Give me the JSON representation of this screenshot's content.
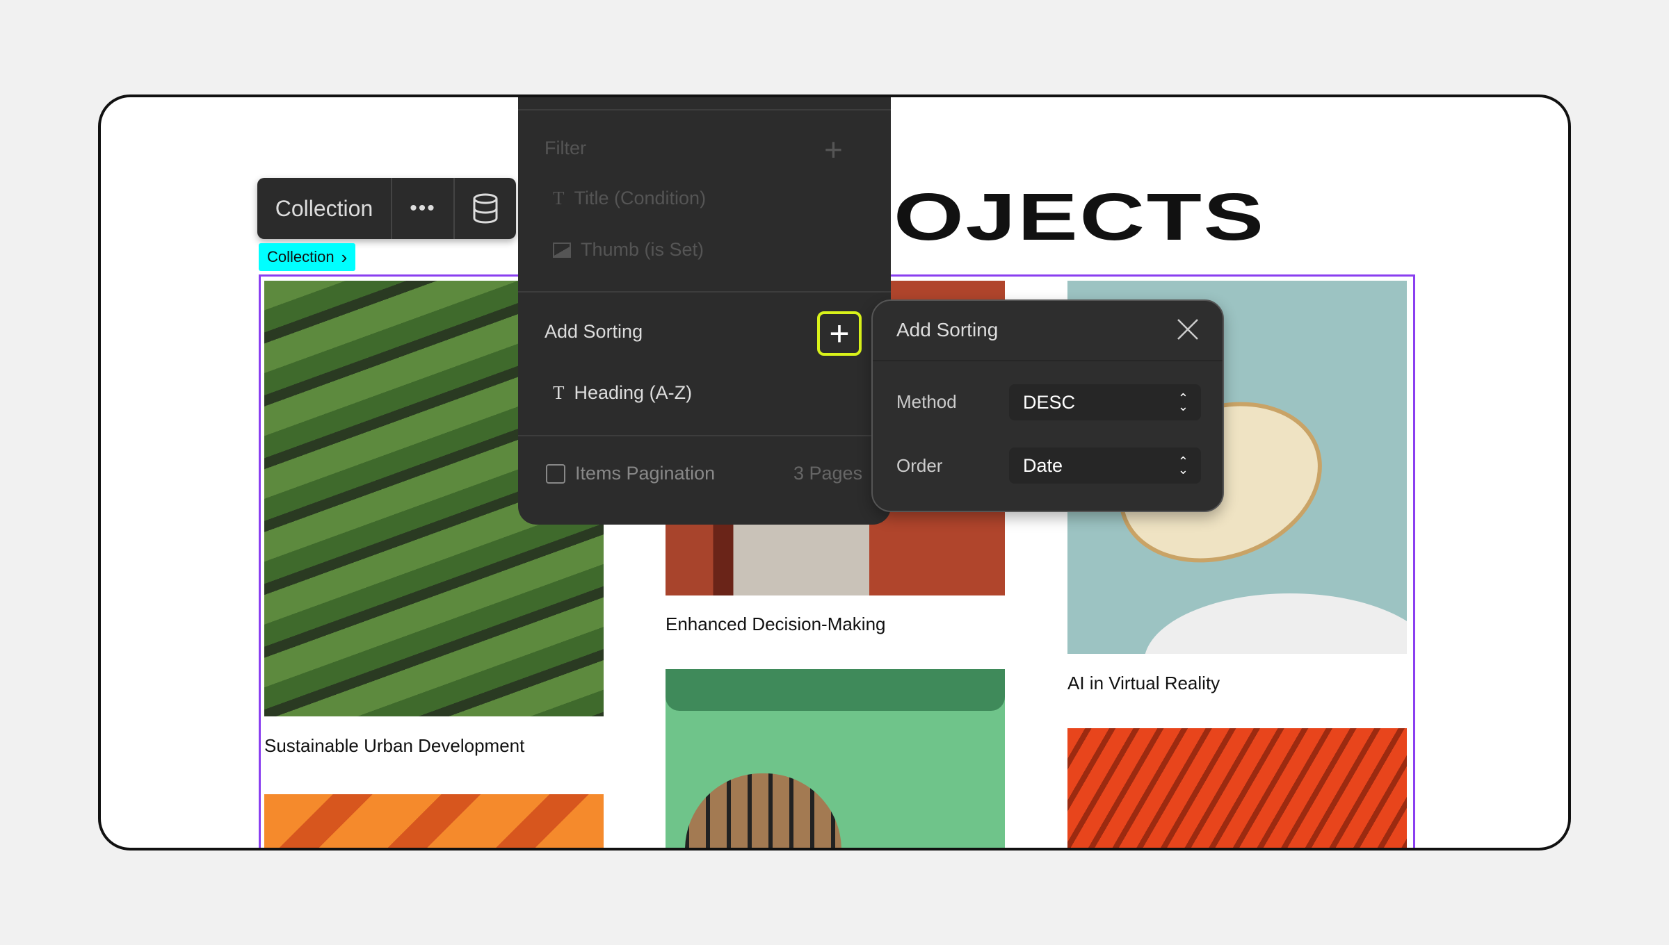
{
  "page": {
    "title": "OJECTS"
  },
  "toolbar": {
    "label": "Collection"
  },
  "tag": {
    "label": "Collection"
  },
  "panel": {
    "filter_label": "Filter",
    "filters": [
      {
        "label": "Title (Condition)",
        "icon": "text-icon"
      },
      {
        "label": "Thumb (is Set)",
        "icon": "image-icon"
      }
    ],
    "sorting_label": "Add Sorting",
    "sorts": [
      {
        "label": "Heading (A-Z)",
        "icon": "text-icon"
      }
    ],
    "pagination_label": "Items Pagination",
    "pagination_value": "3 Pages"
  },
  "popup": {
    "title": "Add Sorting",
    "method_label": "Method",
    "method_value": "DESC",
    "order_label": "Order",
    "order_value": "Date"
  },
  "items": [
    {
      "caption": "Sustainable Urban Development"
    },
    {
      "caption": "Enhanced Decision-Making"
    },
    {
      "caption": "AI in Virtual Reality"
    }
  ],
  "colors": {
    "accent": "#8a3ff0",
    "highlight": "#d9f21a",
    "tag": "#00ffff"
  }
}
